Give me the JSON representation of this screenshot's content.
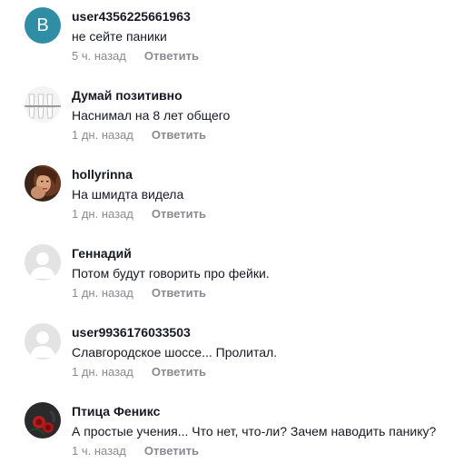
{
  "comments": [
    {
      "avatar_type": "letter",
      "avatar_letter": "B",
      "avatar_color": "#2f8ea6",
      "username": "user4356225661963",
      "text": "не сейте паники",
      "time": "5 ч. назад",
      "reply_label": "Ответить"
    },
    {
      "avatar_type": "image",
      "avatar_icon": "glasses-avatar-icon",
      "username": "Думай позитивно",
      "text": "Наснимал на 8 лет общего",
      "time": "1 дн. назад",
      "reply_label": "Ответить"
    },
    {
      "avatar_type": "image",
      "avatar_icon": "portrait-avatar-icon",
      "username": "hollyrinna",
      "text": "На шмидта видела",
      "time": "1 дн. назад",
      "reply_label": "Ответить"
    },
    {
      "avatar_type": "default",
      "avatar_icon": "default-user-avatar-icon",
      "username": "Геннадий",
      "text": "Потом будут говорить про фейки.",
      "time": "1 дн. назад",
      "reply_label": "Ответить"
    },
    {
      "avatar_type": "default",
      "avatar_icon": "default-user-avatar-icon",
      "username": "user9936176033503",
      "text": "Славгородское шоссе... Пролитал.",
      "time": "1 дн. назад",
      "reply_label": "Ответить"
    },
    {
      "avatar_type": "image",
      "avatar_icon": "roses-avatar-icon",
      "username": "Птица Феникс",
      "text": "А простые учения... Что нет, что-ли? Зачем наводить панику?",
      "time": "1 ч. назад",
      "reply_label": "Ответить"
    }
  ],
  "colors": {
    "text": "#161823",
    "muted": "#8a8b91",
    "default_avatar_bg": "#e3e3e4"
  }
}
